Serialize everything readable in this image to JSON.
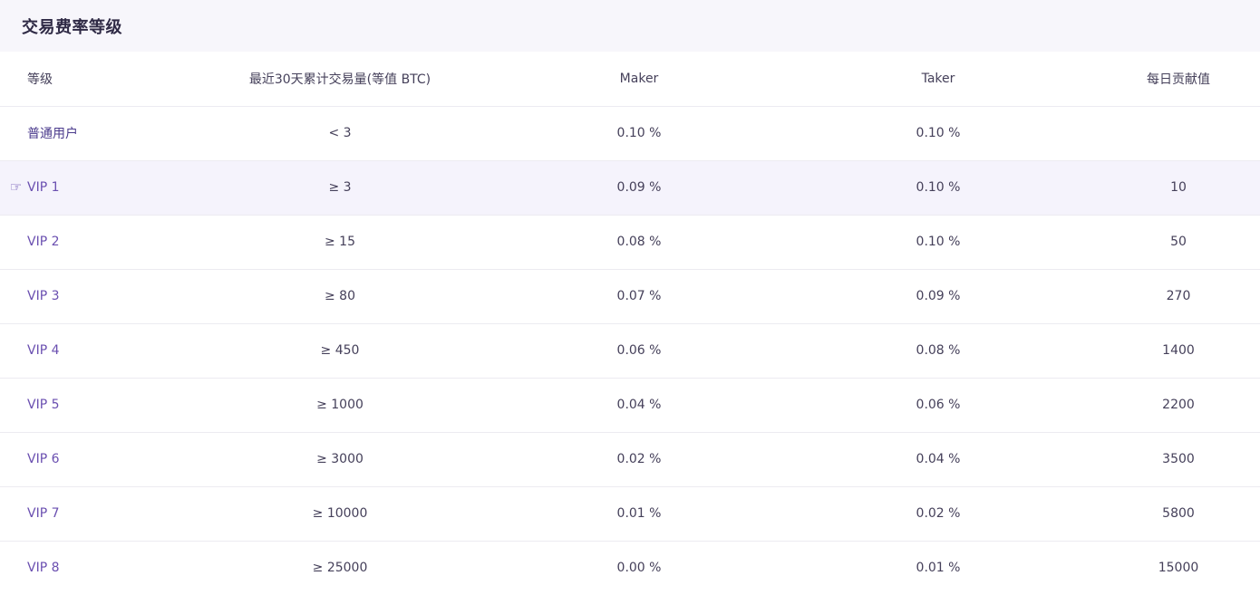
{
  "panel": {
    "title": "交易费率等级"
  },
  "table": {
    "headers": [
      "等级",
      "最近30天累计交易量(等值 BTC)",
      "Maker",
      "Taker",
      "每日贡献值"
    ],
    "current_marker_icon": "hand-pointer-icon",
    "rows": [
      {
        "level": "普通用户",
        "volume": "< 3",
        "maker": "0.10 %",
        "taker": "0.10 %",
        "daily": ""
      },
      {
        "level": "VIP 1",
        "volume": "≥ 3",
        "maker": "0.09 %",
        "taker": "0.10 %",
        "daily": "10"
      },
      {
        "level": "VIP 2",
        "volume": "≥ 15",
        "maker": "0.08 %",
        "taker": "0.10 %",
        "daily": "50"
      },
      {
        "level": "VIP 3",
        "volume": "≥ 80",
        "maker": "0.07 %",
        "taker": "0.09 %",
        "daily": "270"
      },
      {
        "level": "VIP 4",
        "volume": "≥ 450",
        "maker": "0.06 %",
        "taker": "0.08 %",
        "daily": "1400"
      },
      {
        "level": "VIP 5",
        "volume": "≥ 1000",
        "maker": "0.04 %",
        "taker": "0.06 %",
        "daily": "2200"
      },
      {
        "level": "VIP 6",
        "volume": "≥ 3000",
        "maker": "0.02 %",
        "taker": "0.04 %",
        "daily": "3500"
      },
      {
        "level": "VIP 7",
        "volume": "≥ 10000",
        "maker": "0.01 %",
        "taker": "0.02 %",
        "daily": "5800"
      },
      {
        "level": "VIP 8",
        "volume": "≥ 25000",
        "maker": "0.00 %",
        "taker": "0.01 %",
        "daily": "15000"
      }
    ]
  }
}
